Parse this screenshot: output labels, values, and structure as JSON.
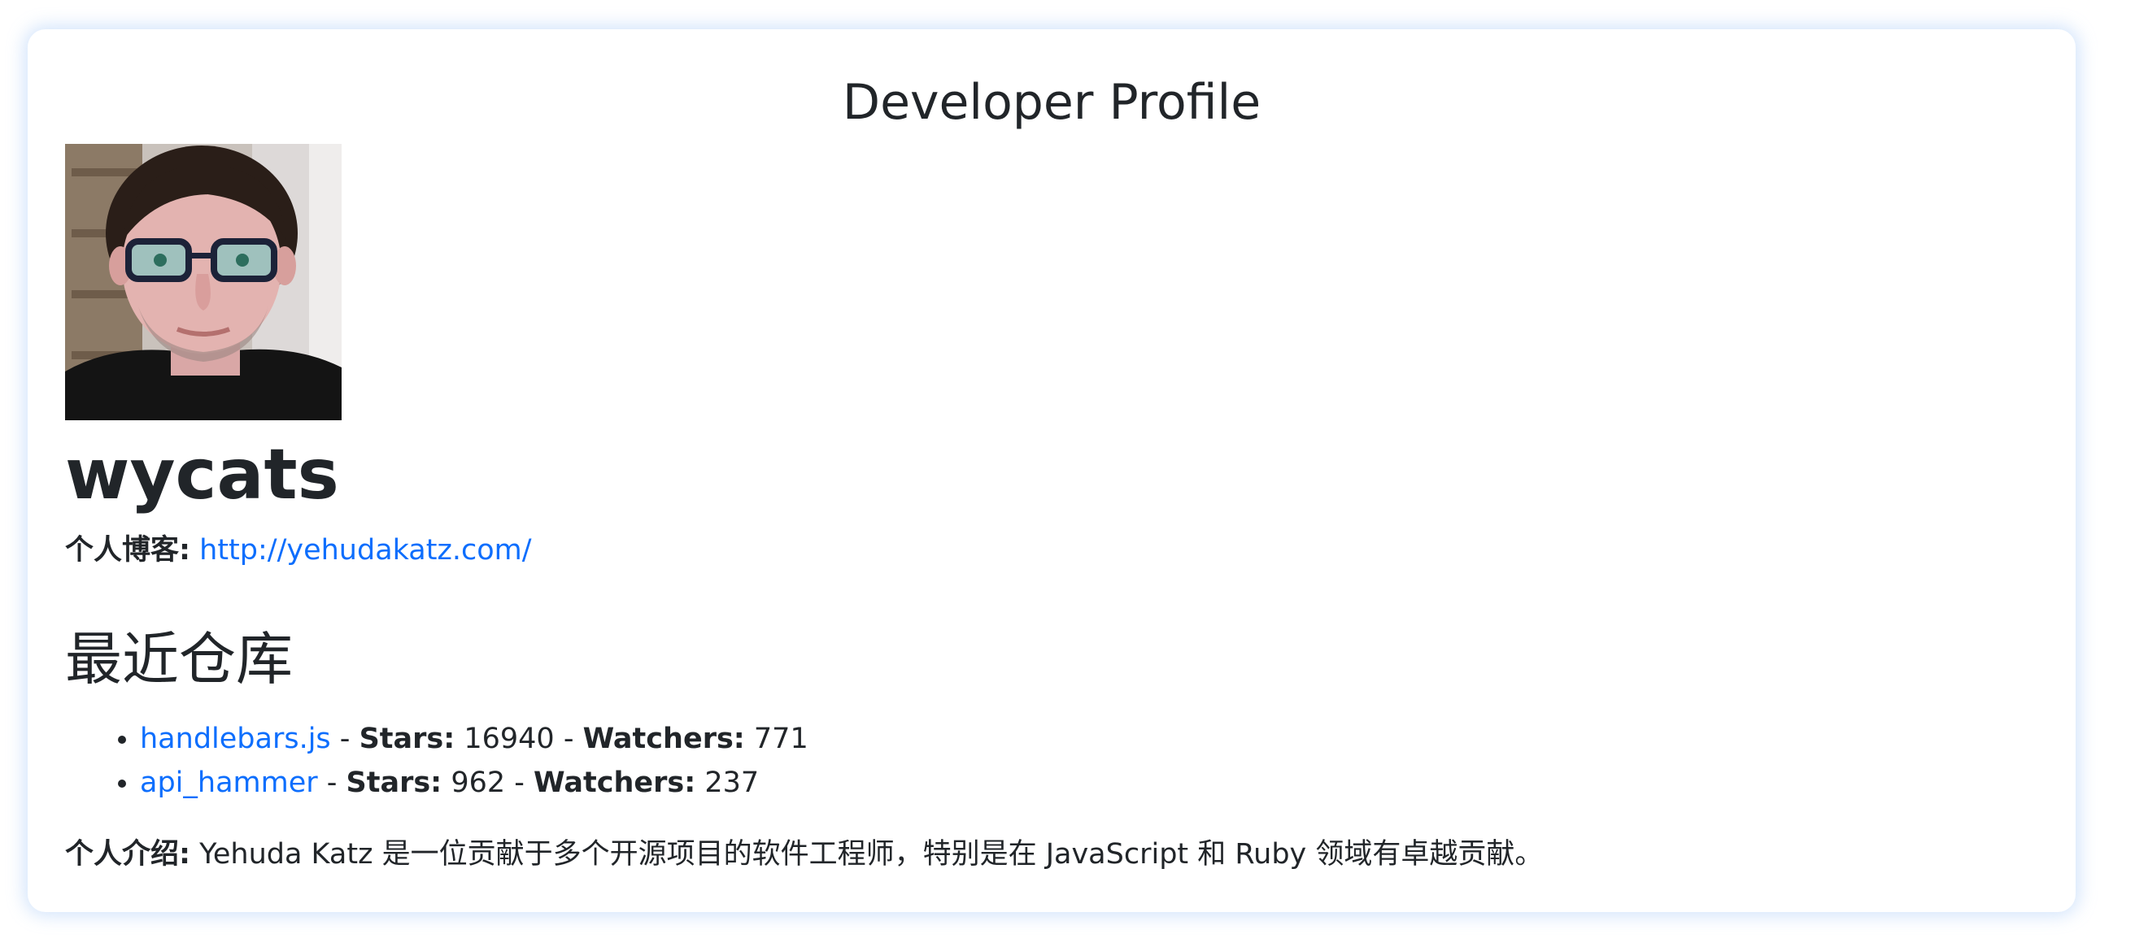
{
  "header": {
    "title": "Developer Profile"
  },
  "profile": {
    "username": "wycats",
    "blog_label": "个人博客:",
    "blog_url": "http://yehudakatz.com/",
    "bio_label": "个人介绍:",
    "bio_text": "Yehuda Katz 是一位贡献于多个开源项目的软件工程师，特别是在 JavaScript 和 Ruby 领域有卓越贡献。"
  },
  "repos": {
    "heading": "最近仓库",
    "items": [
      {
        "name": "handlebars.js",
        "sep1": " - ",
        "stars_label": "Stars:",
        "stars": " 16940",
        "sep2": " - ",
        "watchers_label": "Watchers:",
        "watchers": " 771"
      },
      {
        "name": "api_hammer",
        "sep1": " - ",
        "stars_label": "Stars:",
        "stars": " 962",
        "sep2": " - ",
        "watchers_label": "Watchers:",
        "watchers": " 237"
      }
    ]
  },
  "colors": {
    "link": "#0d6efd",
    "text": "#212529",
    "card_glow": "#8cb9f5"
  }
}
